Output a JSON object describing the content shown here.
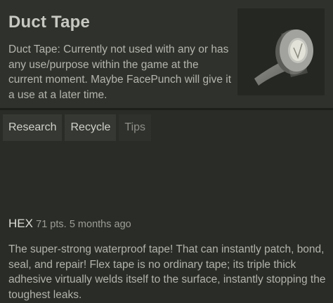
{
  "item": {
    "title": "Duct Tape",
    "description": "Duct Tape: Currently not used with any or has any use/purpose within the game at the current moment. Maybe FacePunch will give it a use at a later time.",
    "image_icon": "duct-tape-roll-icon"
  },
  "tabs": [
    {
      "label": "Research",
      "active": true
    },
    {
      "label": "Recycle",
      "active": true
    },
    {
      "label": "Tips",
      "active": false
    }
  ],
  "comment": {
    "author": "HEX",
    "points": "71 pts.",
    "time": "5 months ago",
    "body": "The super-strong waterproof tape! That can instantly patch, bond, seal, and repair! Flex tape is no ordinary tape; its triple thick adhesive virtually welds itself to the surface, instantly stopping the toughest leaks."
  },
  "colors": {
    "background": "#2a2c27",
    "header_background": "#2f312c",
    "tab_active_background": "#363833"
  }
}
